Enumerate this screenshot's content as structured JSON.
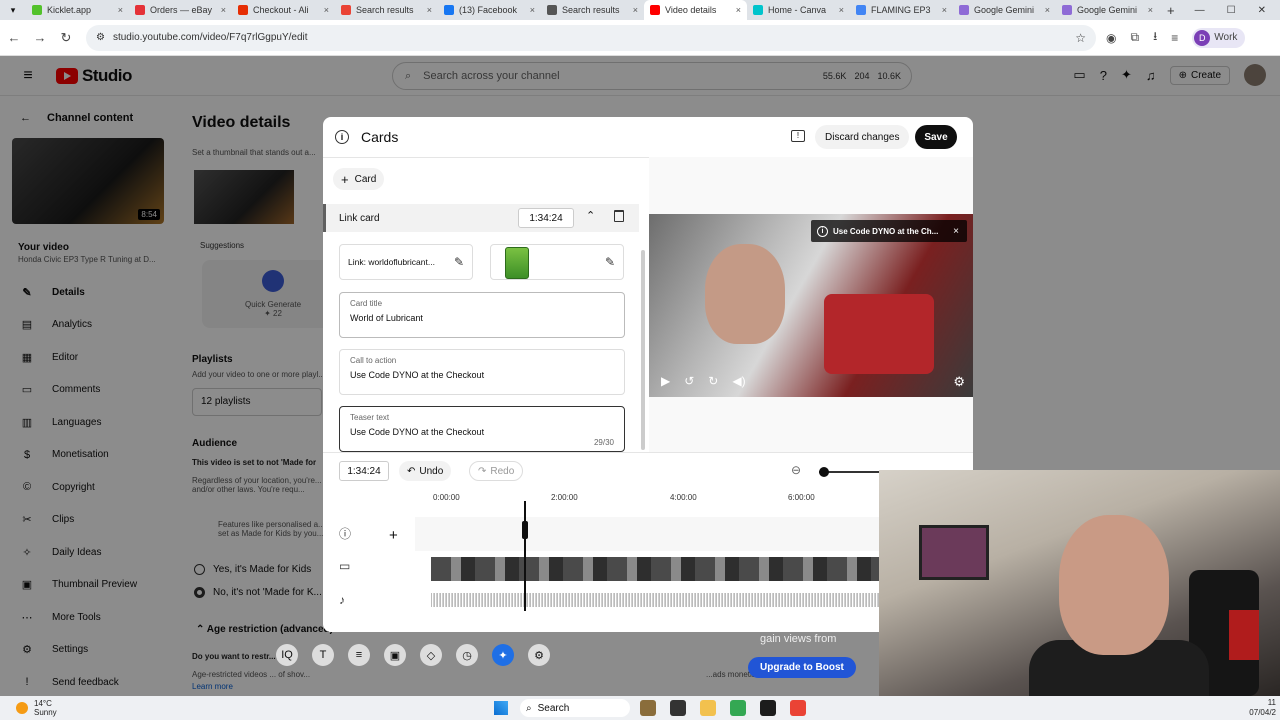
{
  "browser": {
    "tabs": [
      {
        "label": "Kicklet.app",
        "color": "#53c22b"
      },
      {
        "label": "Orders — eBay",
        "color": "#e43137"
      },
      {
        "label": "Checkout - Ali",
        "color": "#e62e04"
      },
      {
        "label": "Search results",
        "color": "#ea4335"
      },
      {
        "label": "(13) Facebook",
        "color": "#1877f2"
      },
      {
        "label": "Search results",
        "color": "#555555"
      },
      {
        "label": "Video details",
        "color": "#ff0000"
      },
      {
        "label": "Home - Canva",
        "color": "#00c4cc"
      },
      {
        "label": "FLAMING EP3",
        "color": "#4285f4"
      },
      {
        "label": "Google Gemini",
        "color": "#8e6bd6"
      },
      {
        "label": "Google Gemini",
        "color": "#8e6bd6"
      }
    ],
    "url": "studio.youtube.com/video/F7q7rlGgpuY/edit",
    "profile_initial": "D",
    "profile_label": "Work"
  },
  "studio_header": {
    "logo_text": "Studio",
    "search_placeholder": "Search across your channel",
    "stats": [
      "55.6K",
      "204",
      "10.6K"
    ],
    "create_label": "Create"
  },
  "leftnav": {
    "back_label": "Channel content",
    "thumb_duration": "8:54",
    "your_video_label": "Your video",
    "video_title": "Honda Civic EP3 Type R Tuning at D...",
    "items": [
      {
        "label": "Details",
        "icon": "✎"
      },
      {
        "label": "Analytics",
        "icon": "▤"
      },
      {
        "label": "Editor",
        "icon": "▦"
      },
      {
        "label": "Comments",
        "icon": "▭"
      },
      {
        "label": "Languages",
        "icon": "▥"
      },
      {
        "label": "Monetisation",
        "icon": "$"
      },
      {
        "label": "Copyright",
        "icon": "©"
      },
      {
        "label": "Clips",
        "icon": "✂"
      },
      {
        "label": "Daily Ideas",
        "icon": "✧"
      },
      {
        "label": "Thumbnail Preview",
        "icon": "▣"
      },
      {
        "label": "More Tools",
        "icon": "⋯"
      },
      {
        "label": "Settings",
        "icon": "⚙"
      },
      {
        "label": "Send feedback",
        "icon": "!"
      }
    ]
  },
  "details_page": {
    "title": "Video details",
    "thumb_hint": "Set a thumbnail that stands out a...",
    "suggestions_label": "Suggestions",
    "quick_generate": "Quick Generate",
    "quick_generate_count": "✦ 22",
    "playlists_label": "Playlists",
    "playlists_hint": "Add your video to one or more playl...",
    "playlists_value": "12 playlists",
    "audience_label": "Audience",
    "audience_text": "This video is set to not 'Made for",
    "audience_note": "Regardless of your location, you're... and/or other laws. You're requ...",
    "features_note": "Features like personalised a... set as Made for Kids by you...",
    "radio_yes": "Yes, it's Made for Kids",
    "radio_no": "No, it's not 'Made for K...",
    "age_label": "Age restriction (advanced)",
    "age_question": "Do you want to restr...",
    "age_note": "Age-restricted videos ... of shov...",
    "learn_more": "Learn more",
    "boost_text": "gain views from",
    "boost_button": "Upgrade to Boost",
    "ads_note": "...ads monetisation"
  },
  "cards_modal": {
    "title": "Cards",
    "discard_label": "Discard changes",
    "save_label": "Save",
    "add_card_label": "Card",
    "card_type": "Link card",
    "card_time": "1:34:24",
    "link_text": "Link: worldoflubricant...",
    "card_title_label": "Card title",
    "card_title_value": "World of Lubricant",
    "cta_label": "Call to action",
    "cta_value": "Use Code DYNO at the Checkout",
    "teaser_label": "Teaser text",
    "teaser_value": "Use Code DYNO at the Checkout",
    "teaser_count": "29/30",
    "preview_teaser": "Use Code DYNO at the Ch...",
    "timeline_time": "1:34:24",
    "undo_label": "Undo",
    "redo_label": "Redo",
    "ruler_ticks": [
      "0:00:00",
      "2:00:00",
      "4:00:00",
      "6:00:00"
    ]
  },
  "taskbar": {
    "temp": "14°C",
    "weather": "Sunny",
    "search_label": "Search",
    "time": "11",
    "date": "07/04/2"
  }
}
